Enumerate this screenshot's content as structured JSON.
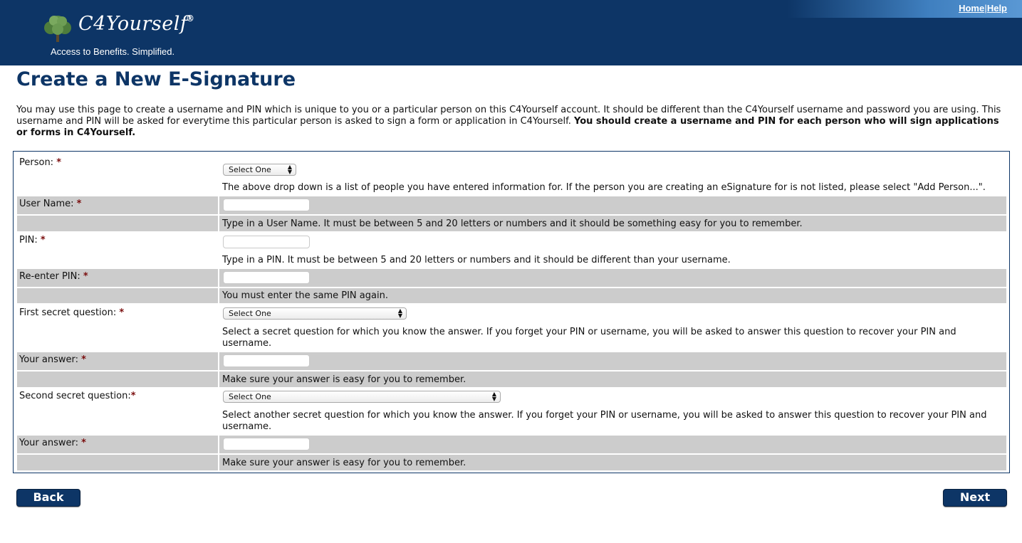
{
  "header": {
    "logo_text": "C4Yourself",
    "logo_reg": "®",
    "tagline": "Access to Benefits.  Simplified.",
    "links": {
      "home": "Home",
      "separator": "|",
      "help": "Help"
    }
  },
  "page": {
    "title": "Create a New E-Signature",
    "intro_text": "You may use this page to create a username and PIN which is unique to you or a particular person on this C4Yourself account. It should be different than the C4Yourself username and password you are using. This username and PIN will be asked for everytime this particular person is asked to sign a form or application in C4Yourself.",
    "intro_bold": "You should create a username and PIN for each person who will sign applications or forms in C4Yourself."
  },
  "form": {
    "required_mark": "*",
    "person": {
      "label": "Person: ",
      "selected": "Select One",
      "help": "The above drop down is a list of people you have entered information for. If the person you are creating an eSignature for is not listed, please select \"Add Person...\"."
    },
    "username": {
      "label": "User Name: ",
      "value": "",
      "help": "Type in a User Name. It must be between 5 and 20 letters or numbers and it should be something easy for you to remember."
    },
    "pin": {
      "label": "PIN: ",
      "value": "",
      "help": "Type in a PIN. It must be between 5 and 20 letters or numbers and it should be different than your username."
    },
    "reenter_pin": {
      "label": "Re-enter PIN: ",
      "value": "",
      "help": "You must enter the same PIN again."
    },
    "first_question": {
      "label": "First secret question: ",
      "selected": "Select One",
      "help": "Select a secret question for which you know the answer. If you forget your PIN or username, you will be asked to answer this question to recover your PIN and username."
    },
    "first_answer": {
      "label": "Your answer: ",
      "value": "",
      "help": "Make sure your answer is easy for you to remember."
    },
    "second_question": {
      "label": "Second secret question:",
      "selected": "Select One",
      "help": "Select another secret question for which you know the answer. If you forget your PIN or username, you will be asked to answer this question to recover your PIN and username."
    },
    "second_answer": {
      "label": "Your answer: ",
      "value": "",
      "help": "Make sure your answer is easy for you to remember."
    }
  },
  "buttons": {
    "back": "Back",
    "next": "Next"
  },
  "colors": {
    "brand_navy": "#0d3566",
    "row_shade": "#cccccc",
    "required": "#7a0d0d"
  }
}
